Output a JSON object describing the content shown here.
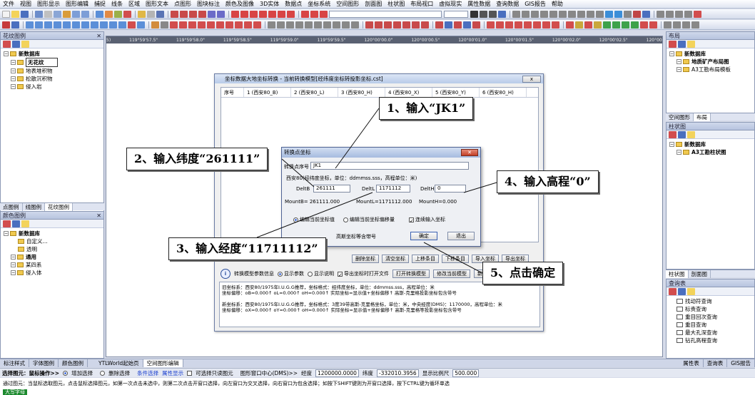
{
  "menu": [
    "文件",
    "视图",
    "图形显示",
    "图形编辑",
    "捕捉",
    "线条",
    "区域",
    "图形文本",
    "点图形",
    "图块标注",
    "颜色及图像",
    "3D实体",
    "数据点",
    "坐标系统",
    "空间图形",
    "剖面图",
    "柱状图",
    "布局视口",
    "虚拟现实",
    "属性数据",
    "查询数据",
    "GIS报告",
    "帮助"
  ],
  "left_panel": {
    "title": "花纹图例",
    "tree": [
      {
        "label": "新数据库",
        "level": 0,
        "bold": true
      },
      {
        "label": "无花纹",
        "level": 1,
        "bold": true,
        "selected": true
      },
      {
        "label": "地表堆积物",
        "level": 1
      },
      {
        "label": "松散沉积物",
        "level": 1
      },
      {
        "label": "侵入岩",
        "level": 1
      }
    ],
    "tabs": [
      "点图例",
      "线图例",
      "花纹图例"
    ]
  },
  "left_panel2": {
    "title": "颜色图例",
    "tree": [
      {
        "label": "新数据库",
        "level": 0,
        "bold": true
      },
      {
        "label": "自定义...",
        "level": 2
      },
      {
        "label": "透明",
        "level": 2
      },
      {
        "label": "通用",
        "level": 1,
        "bold": true
      },
      {
        "label": "某四系",
        "level": 1
      },
      {
        "label": "侵入体",
        "level": 1
      }
    ],
    "tabs": [
      "标注样式",
      "字体图例",
      "颜色图例"
    ]
  },
  "right_panel": {
    "title": "布局",
    "tree": [
      {
        "label": "新数据库",
        "level": 0,
        "bold": true
      },
      {
        "label": "地质矿产布局图",
        "level": 1,
        "bold": true
      },
      {
        "label": "A3工勘布局模板",
        "level": 1
      }
    ],
    "tabs": [
      "空间图形",
      "布局"
    ]
  },
  "right_panel2": {
    "title": "柱状图",
    "tree": [
      {
        "label": "新数据库",
        "level": 0,
        "bold": true
      },
      {
        "label": "A3工勘柱状图",
        "level": 1,
        "bold": true
      }
    ],
    "tabs": [
      "柱状图",
      "剖面图"
    ]
  },
  "right_panel3": {
    "title": "查询表",
    "items": [
      "找动符查询",
      "标责查询",
      "重目回次查询",
      "重目查询",
      "最大孔深查询",
      "钻孔高程查询"
    ],
    "tabs": [
      "属性表",
      "查询表",
      "GIS报告"
    ]
  },
  "ruler": [
    "5)",
    "119°59'57.5\"",
    "119°59'58.0\"",
    "119°59'58.5\"",
    "119°59'59.0\"",
    "119°59'59.5\"",
    "120°00'00.0\"",
    "120°00'00.5\"",
    "120°00'01.0\"",
    "120°00'01.5\"",
    "120°00'02.0\"",
    "120°00'02.5\"",
    "120°00'03.0\""
  ],
  "dialog": {
    "title": "坐标数据大地坐标转换 - 当前转换模型[经纬度坐标转投影坐标.cst]",
    "close": "x",
    "columns": [
      "序号",
      "1 (西安80_B)",
      "2 (西安80_L)",
      "3 (西安80_H)",
      "4 (西安80_X)",
      "5 (西安80_Y)",
      "6 (西安80_H)"
    ],
    "buttons": [
      "删除坐标",
      "清空坐标",
      "上移条目",
      "下移条目",
      "导入坐标",
      "导出坐标"
    ],
    "options_info": "转换模型参数信息",
    "opt_show_params": "显示参数",
    "opt_show_desc": "显示说明",
    "opt_export": "导出坐标时打开文件",
    "btn_open_model": "打开转换模型",
    "btn_modify_model": "修改当前模型",
    "btn_new_model": "新建转换",
    "info_lines": [
      "旧坐标系：西安80/1975年I.U.G.G推荐，坐标格式：经纬度坐标，单位：ddmmss.sss，高程单位：米",
      "坐标偏移：oB=0.000↑ oL=0.000↑ oH=0.000↑ 实际坐标=显示值+坐标偏移↑ 高斯-克里格投影坐标包含带号",
      "",
      "新坐标系：西安80/1975年I.U.G.G推荐，坐标格式：3度39带高斯-克里格坐标，单位：米，中央经度(DMS)：1170000，高程单位：米",
      "坐标偏移：oX=0.000↑ oY=0.000↑ oH=0.000↑ 实际坐标=显示值+坐标偏移↑ 高斯-克里格等投影坐标包含带号"
    ]
  },
  "sub": {
    "title": "转换点坐标",
    "seq_label": "转换点序号",
    "seq_value": "JK1",
    "coord_desc": "西安80(经纬度坐标，单位：ddmmss.sss，高程单位：米)",
    "b_label": "DeltB",
    "b_value": "261111",
    "l_label": "DeltL",
    "l_value": "1171112",
    "h_label": "DeltH",
    "h_value": "0",
    "mount_b": "MountB= 261111.000",
    "mount_l": "MountL=1171112.000",
    "mount_h": "MountH=0.000",
    "opt1": "编辑当前坐标值",
    "opt2": "编辑当前坐标偏移量",
    "opt3": "连续输入坐标",
    "gauss": "高斯坐标等含带号",
    "ok": "确定",
    "cancel": "退出"
  },
  "callouts": {
    "c1": "1、输入“JK1”",
    "c2": "2、输入纬度“261111”",
    "c3": "3、输入经度“11711112”",
    "c4": "4、输入高程“0”",
    "c5": "5、点击确定"
  },
  "doc_tabs": [
    "YTLWorld起始页",
    "空间图形编辑"
  ],
  "status": {
    "s1": "选择图元：鼠标操作>>",
    "s2": "增加选择",
    "s3": "删除选择",
    "s4": "条件选择",
    "s5": "属性显示",
    "s6": "可选择只读图元",
    "s7": "图形窗口中心(DMS)>>",
    "s8": "经度",
    "s9": "1200000.0000",
    "s10": "纬度",
    "s11": "-332010.3956",
    "s12": "显示比例尺",
    "s13": "500.000"
  },
  "hint": "通过图元：当鼠标选取图元，点击鼠标选择图元，如第一次点击未选中，则第二次点击开窗口选择，向左窗口为交叉选择，向右窗口为包含选择；如按下SHIFT键则为开窗口选择，按下CTRL键为循环单选",
  "ime": "大写字母"
}
